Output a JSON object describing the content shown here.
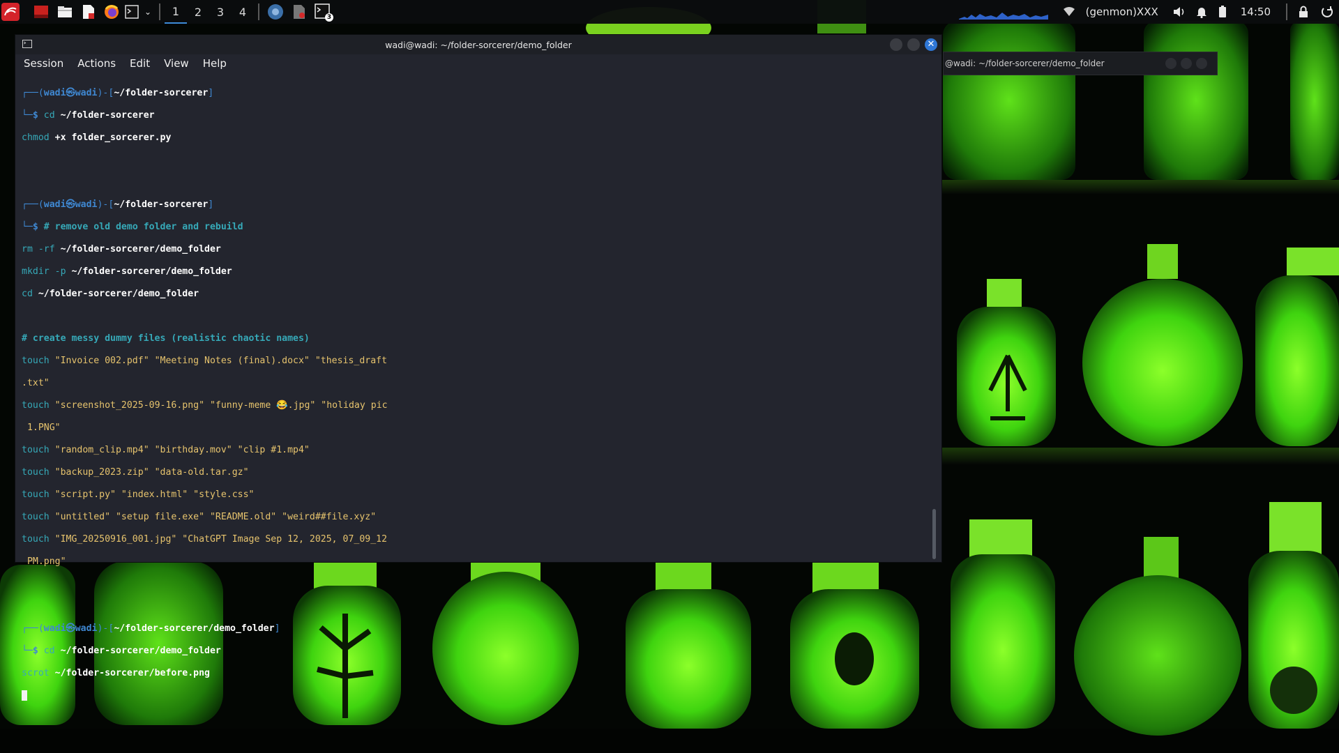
{
  "panel": {
    "workspaces": [
      "1",
      "2",
      "3",
      "4"
    ],
    "active_workspace": "1",
    "genmon_label": "(genmon)XXX",
    "clock": "14:50",
    "terminal_badge": "3",
    "icons": [
      "kali-menu-icon",
      "show-desktop-icon",
      "file-manager-icon",
      "text-editor-icon",
      "firefox-icon",
      "terminal-icon",
      "chevron-down-icon",
      "chromium-icon",
      "document-viewer-icon",
      "terminal-icon",
      "network-icon",
      "volume-icon",
      "notifications-icon",
      "battery-icon",
      "lock-icon",
      "power-icon"
    ]
  },
  "background_window": {
    "title": "@wadi: ~/folder-sorcerer/demo_folder"
  },
  "window": {
    "title": "wadi@wadi: ~/folder-sorcerer/demo_folder",
    "menu": [
      "Session",
      "Actions",
      "Edit",
      "View",
      "Help"
    ]
  },
  "terminal": {
    "prompt1": {
      "user": "wadi",
      "host": "wadi",
      "path": "~/folder-sorcerer"
    },
    "block1": [
      {
        "cmd": "cd",
        "args": "~/folder-sorcerer"
      },
      {
        "cmd": "chmod",
        "args": "+x folder_sorcerer.py"
      }
    ],
    "prompt2": {
      "user": "wadi",
      "host": "wadi",
      "path": "~/folder-sorcerer"
    },
    "block2_comment": "# remove old demo folder and rebuild",
    "block2": [
      {
        "cmd": "rm -rf",
        "args": "~/folder-sorcerer/demo_folder"
      },
      {
        "cmd": "mkdir -p",
        "args": "~/folder-sorcerer/demo_folder"
      },
      {
        "cmd": "cd",
        "args": "~/folder-sorcerer/demo_folder"
      }
    ],
    "block2_comment2": "# create messy dummy files (realistic chaotic names)",
    "touch_lines": [
      "\"Invoice 002.pdf\" \"Meeting Notes (final).docx\" \"thesis_draft",
      ".txt\"",
      "\"screenshot_2025-09-16.png\" \"funny-meme 😂.jpg\" \"holiday pic",
      " 1.PNG\"",
      "\"random_clip.mp4\" \"birthday.mov\" \"clip #1.mp4\"",
      "\"backup_2023.zip\" \"data-old.tar.gz\"",
      "\"script.py\" \"index.html\" \"style.css\"",
      "\"untitled\" \"setup file.exe\" \"README.old\" \"weird##file.xyz\"",
      "\"IMG_20250916_001.jpg\" \"ChatGPT Image Sep 12, 2025, 07_09_12",
      " PM.png\""
    ],
    "touch_cmd": "touch",
    "prompt3": {
      "user": "wadi",
      "host": "wadi",
      "path": "~/folder-sorcerer/demo_folder"
    },
    "block3": [
      {
        "cmd": "cd",
        "args": "~/folder-sorcerer/demo_folder"
      },
      {
        "cmd": "scrot",
        "args": "~/folder-sorcerer/before.png"
      }
    ]
  }
}
